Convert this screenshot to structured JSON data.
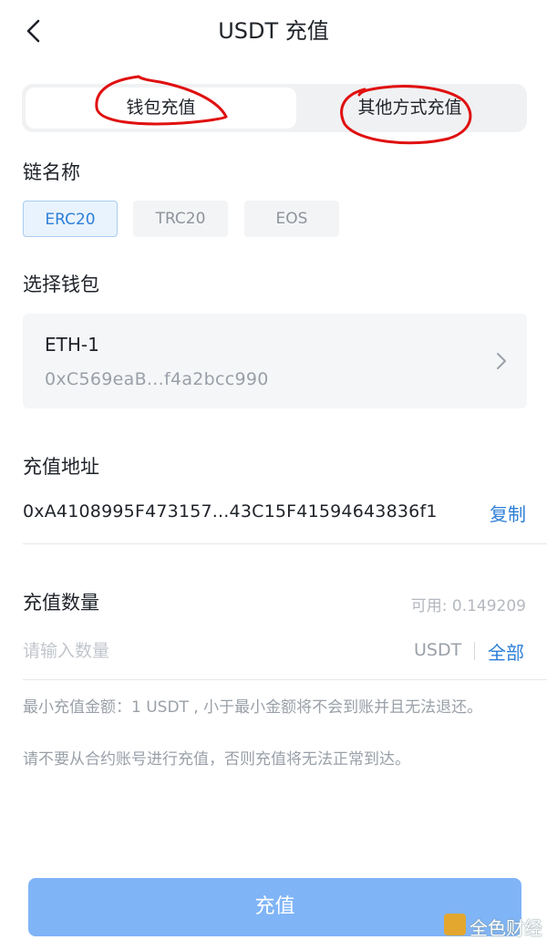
{
  "header": {
    "title": "USDT 充值"
  },
  "tabs": {
    "wallet": "钱包充值",
    "other": "其他方式充值"
  },
  "chain": {
    "label": "链名称",
    "options": [
      "ERC20",
      "TRC20",
      "EOS"
    ],
    "selected": "ERC20"
  },
  "wallet": {
    "label": "选择钱包",
    "name": "ETH-1",
    "address": "0xC569eaB...f4a2bcc990"
  },
  "deposit_address": {
    "label": "充值地址",
    "value": "0xA4108995F473157...43C15F41594643836f1",
    "copy_label": "复制"
  },
  "amount": {
    "label": "充值数量",
    "available": "可用: 0.149209",
    "placeholder": "请输入数量",
    "unit": "USDT",
    "all_label": "全部"
  },
  "notes": [
    "最小充值金额：1 USDT , 小于最小金额将不会到账并且无法退还。",
    "请不要从合约账号进行充值，否则充值将无法正常到达。"
  ],
  "submit_label": "充值",
  "watermark": "全色财经",
  "colors": {
    "accent": "#2d7fd8",
    "button": "#7fb4f7",
    "annotation": "#e01010"
  }
}
